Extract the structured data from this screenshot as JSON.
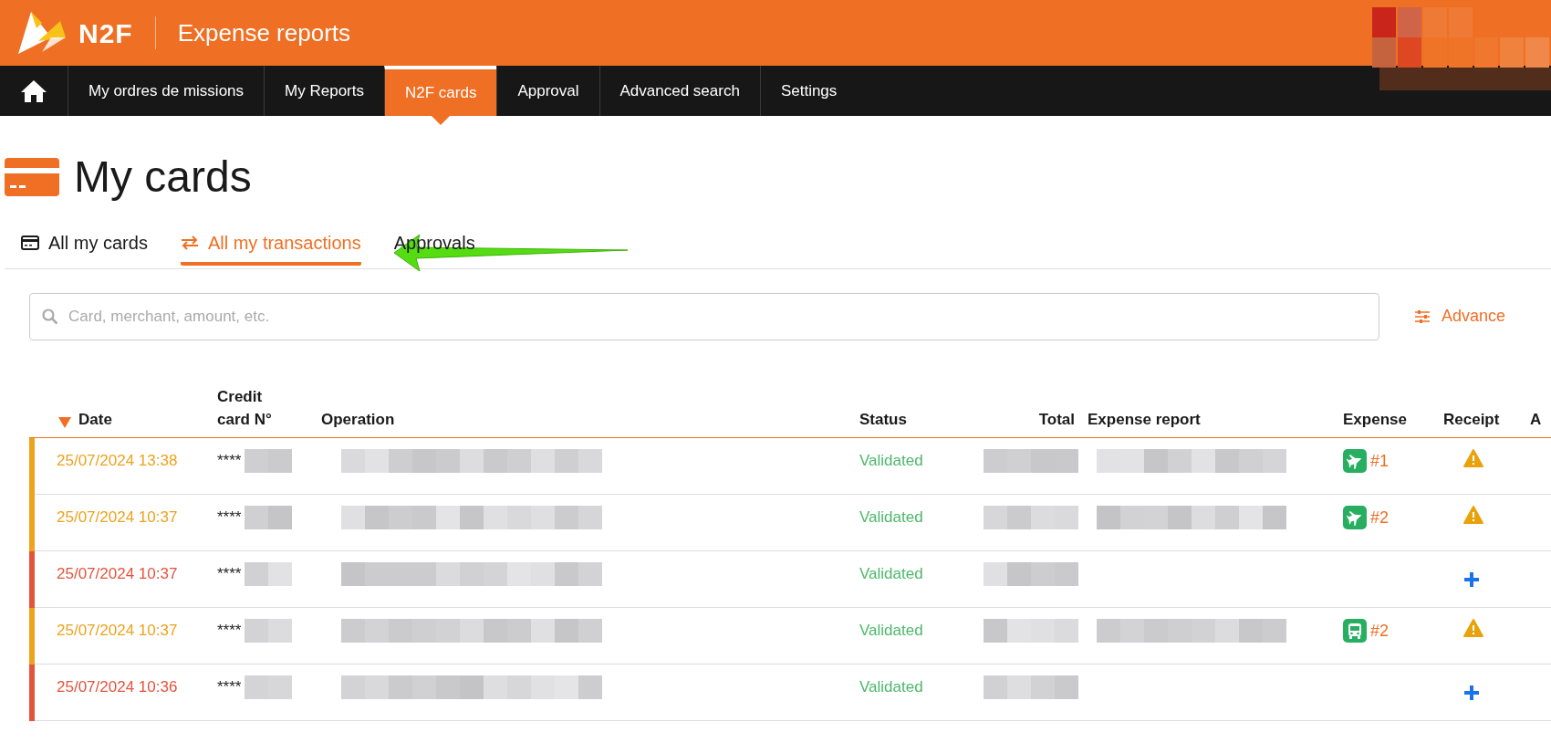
{
  "header": {
    "logo_text": "N2F",
    "app_title": "Expense reports"
  },
  "nav": [
    {
      "kind": "home",
      "selected": false
    },
    {
      "kind": "link",
      "label": "My ordres de missions",
      "selected": false
    },
    {
      "kind": "link",
      "label": "My Reports",
      "selected": false
    },
    {
      "kind": "link",
      "label": "N2F cards",
      "selected": true
    },
    {
      "kind": "link",
      "label": "Approval",
      "selected": false
    },
    {
      "kind": "link",
      "label": "Advanced search",
      "selected": false
    },
    {
      "kind": "link",
      "label": "Settings",
      "selected": false
    }
  ],
  "page_title": "My cards",
  "tabs": [
    {
      "kind": "card",
      "label": "All my cards",
      "selected": false
    },
    {
      "kind": "transfer",
      "label": "All my transactions",
      "selected": true
    },
    {
      "kind": "plain",
      "label": "Approvals",
      "selected": false
    }
  ],
  "annotations": [
    {
      "kind": "arrow"
    }
  ],
  "search": {
    "placeholder": "Card, merchant, amount, etc."
  },
  "advanced_link": "Advance",
  "table": {
    "columns": [
      {
        "label": "Date",
        "sorted": true
      },
      {
        "label": "Credit card N°",
        "sorted": false
      },
      {
        "label": "Operation",
        "sorted": false
      },
      {
        "label": "Status",
        "sorted": false
      },
      {
        "label": "Total",
        "sorted": false
      },
      {
        "label": "Expense report",
        "sorted": false
      },
      {
        "label": "Expense",
        "sorted": false
      },
      {
        "label": "Receipt",
        "sorted": false
      },
      {
        "label": "A",
        "sorted": false
      }
    ],
    "rows": [
      {
        "date": "25/07/2024 13:38",
        "color": "#eea21d",
        "card": "****",
        "status": "Validated",
        "expense": {
          "kind": "plane",
          "label": "#1"
        },
        "receipt": {
          "kind": "warning"
        }
      },
      {
        "date": "25/07/2024 10:37",
        "color": "#eea21d",
        "card": "****",
        "status": "Validated",
        "expense": {
          "kind": "plane",
          "label": "#2"
        },
        "receipt": {
          "kind": "warning"
        }
      },
      {
        "date": "25/07/2024 10:37",
        "color": "#e5533c",
        "card": "****",
        "status": "Validated",
        "receipt": {
          "kind": "add"
        }
      },
      {
        "date": "25/07/2024 10:37",
        "color": "#eea21d",
        "card": "****",
        "status": "Validated",
        "expense": {
          "kind": "bus",
          "label": "#2"
        },
        "receipt": {
          "kind": "warning"
        }
      },
      {
        "date": "25/07/2024 10:36",
        "color": "#e5533c",
        "card": "****",
        "status": "Validated",
        "receipt": {
          "kind": "add"
        }
      }
    ]
  }
}
